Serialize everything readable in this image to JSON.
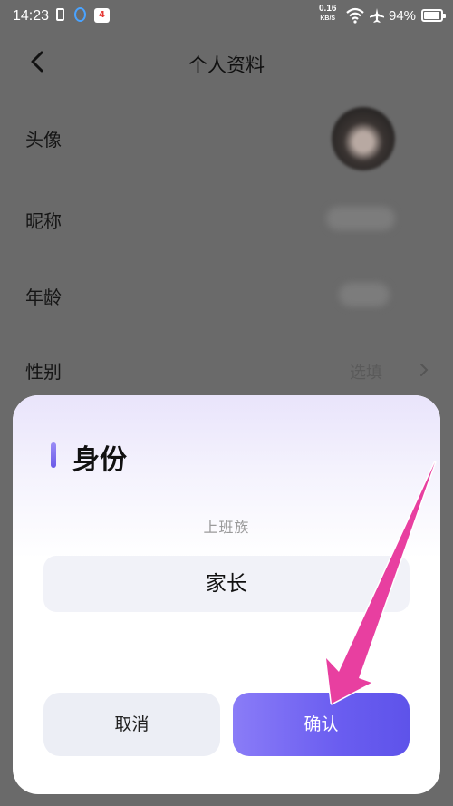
{
  "status_bar": {
    "time": "14:23",
    "notification_count": "4",
    "net_speed": "0.16",
    "net_unit": "KB/S",
    "battery": "94%",
    "battery_level": 0.94
  },
  "header": {
    "title": "个人资料"
  },
  "profile_rows": [
    {
      "label": "头像"
    },
    {
      "label": "昵称"
    },
    {
      "label": "年龄"
    },
    {
      "label": "性别",
      "value": "选填"
    }
  ],
  "sheet": {
    "title": "身份",
    "picker_prev_option": "上班族",
    "picker_selected": "家长",
    "cancel_label": "取消",
    "confirm_label": "确认"
  },
  "colors": {
    "accent": "#6a5df0",
    "overlay": "#6a6a6a",
    "annotation_arrow": "#e83fa0"
  }
}
